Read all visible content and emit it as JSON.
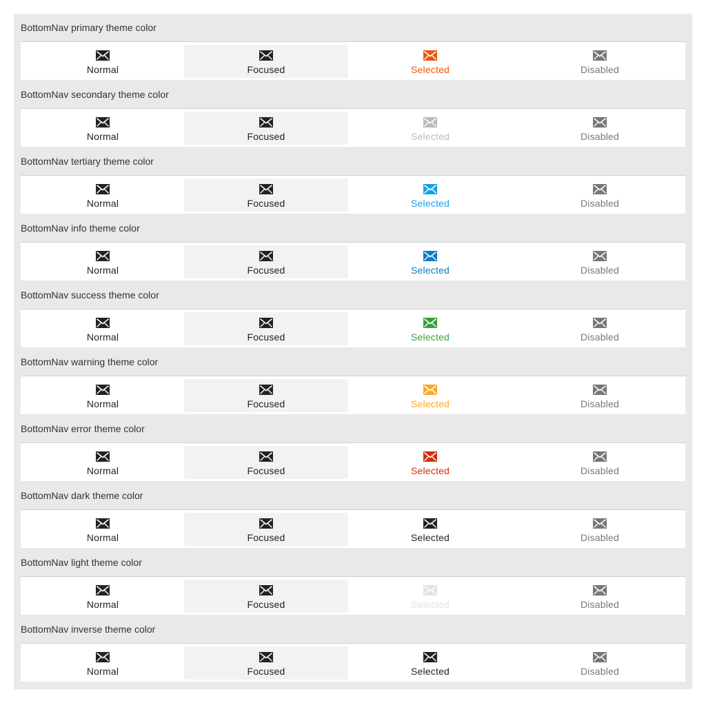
{
  "states": {
    "normal": "Normal",
    "focused": "Focused",
    "selected": "Selected",
    "disabled": "Disabled"
  },
  "icon": "envelope-icon",
  "colors": {
    "normal": "#222222",
    "disabled": "#777777",
    "focus_background": "#f2f2f2"
  },
  "sections": [
    {
      "id": "primary",
      "title": "BottomNav primary theme color",
      "selected_color": "#e8590c"
    },
    {
      "id": "secondary",
      "title": "BottomNav secondary theme color",
      "selected_color": "#bbbbbb"
    },
    {
      "id": "tertiary",
      "title": "BottomNav tertiary theme color",
      "selected_color": "#1ba1e2"
    },
    {
      "id": "info",
      "title": "BottomNav info theme color",
      "selected_color": "#0a7cc2"
    },
    {
      "id": "success",
      "title": "BottomNav success theme color",
      "selected_color": "#37a03a"
    },
    {
      "id": "warning",
      "title": "BottomNav warning theme color",
      "selected_color": "#ffa726"
    },
    {
      "id": "error",
      "title": "BottomNav error theme color",
      "selected_color": "#d32f0f"
    },
    {
      "id": "dark",
      "title": "BottomNav dark theme color",
      "selected_color": "#222222"
    },
    {
      "id": "light",
      "title": "BottomNav light theme color",
      "selected_color": "#e2e2e2"
    },
    {
      "id": "inverse",
      "title": "BottomNav inverse theme color",
      "selected_color": "#222222"
    }
  ]
}
